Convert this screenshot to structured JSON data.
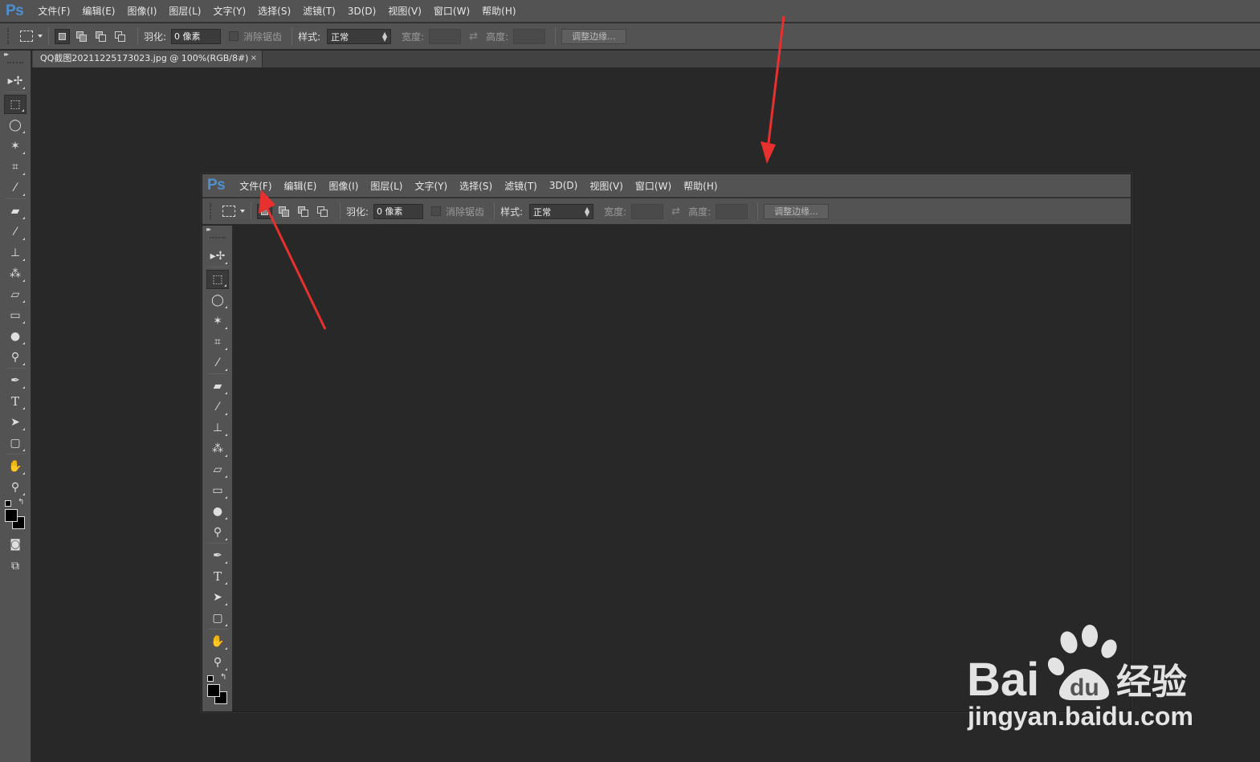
{
  "app": {
    "logo": "Ps",
    "menu": [
      "文件(F)",
      "编辑(E)",
      "图像(I)",
      "图层(L)",
      "文字(Y)",
      "选择(S)",
      "滤镜(T)",
      "3D(D)",
      "视图(V)",
      "窗口(W)",
      "帮助(H)"
    ]
  },
  "options": {
    "feather_label": "羽化:",
    "feather_value": "0 像素",
    "antialias_label": "消除锯齿",
    "style_label": "样式:",
    "style_value": "正常",
    "width_label": "宽度:",
    "height_label": "高度:",
    "refine_edge_button": "调整边缘..."
  },
  "document": {
    "tab_title": "QQ截图20211225173023.jpg @ 100%(RGB/8#)",
    "close_glyph": "×"
  },
  "tools": [
    "move-tool",
    "rectangular-marquee-tool",
    "lasso-tool",
    "magic-wand-tool",
    "crop-tool",
    "eyedropper-tool",
    "healing-brush-tool",
    "brush-tool",
    "clone-stamp-tool",
    "history-brush-tool",
    "eraser-tool",
    "gradient-tool",
    "blur-tool",
    "dodge-tool",
    "pen-tool",
    "type-tool",
    "path-selection-tool",
    "rectangle-tool",
    "hand-tool",
    "zoom-tool"
  ],
  "annotations": {
    "arrow_color": "#e8302e"
  },
  "watermark": {
    "brand": "Bai 经验",
    "url": "jingyan.baidu.com"
  }
}
